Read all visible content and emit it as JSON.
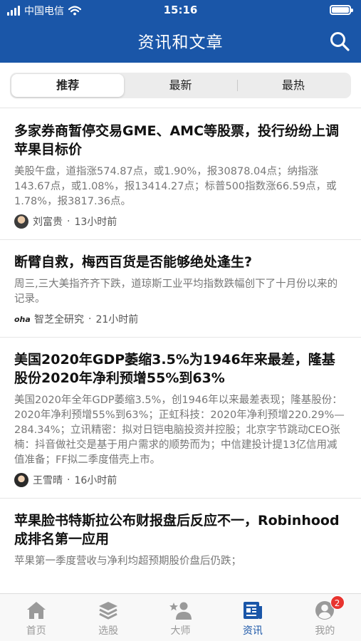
{
  "status_bar": {
    "carrier": "中国电信",
    "time": "15:16"
  },
  "header": {
    "title": "资讯和文章"
  },
  "segments": [
    {
      "label": "推荐",
      "active": true
    },
    {
      "label": "最新",
      "active": false
    },
    {
      "label": "最热",
      "active": false
    }
  ],
  "articles": [
    {
      "title": "多家券商暂停交易GME、AMC等股票，投行纷纷上调苹果目标价",
      "summary": "美股午盘，道指涨574.87点，或1.90%，报30878.04点；纳指涨143.67点，或1.08%，报13414.27点；标普500指数涨66.59点，或1.78%，报3817.36点。",
      "author": "刘富贵",
      "time": "13小时前"
    },
    {
      "title": "断臂自救，梅西百货是否能够绝处逢生?",
      "summary": "周三,三大美指齐齐下跌，道琼斯工业平均指数跌幅创下了十月份以来的记录。",
      "author": "智芝全研究",
      "time": "21小时前",
      "logo_text": "ohai"
    },
    {
      "title": "美国2020年GDP萎缩3.5%为1946年来最差，隆基股份2020年净利预增55%到63%",
      "summary": "美国2020年全年GDP萎缩3.5%，创1946年以来最差表现；隆基股份：2020年净利预增55%到63%；正虹科技：2020年净利预增220.29%—284.34%；立讯精密：拟对日铠电脑投资并控股；北京字节跳动CEO张楠：抖音做社交是基于用户需求的顺势而为；中信建投计提13亿信用减值准备；FF拟二季度借壳上市。",
      "author": "王雪晴",
      "time": "16小时前"
    },
    {
      "title": "苹果脸书特斯拉公布财报盘后反应不一，Robinhood成排名第一应用",
      "summary": "苹果第一季度营收与净利均超预期股价盘后仍跌；"
    }
  ],
  "meta_separator": "·",
  "tabbar": [
    {
      "label": "首页",
      "icon": "home-icon",
      "active": false
    },
    {
      "label": "选股",
      "icon": "layers-icon",
      "active": false
    },
    {
      "label": "大师",
      "icon": "master-icon",
      "active": false
    },
    {
      "label": "资讯",
      "icon": "news-icon",
      "active": true
    },
    {
      "label": "我的",
      "icon": "profile-icon",
      "active": false,
      "badge": "2"
    }
  ],
  "colors": {
    "brand": "#1a56a8",
    "badge": "#e8342f",
    "inactive": "#9a9a9a"
  }
}
